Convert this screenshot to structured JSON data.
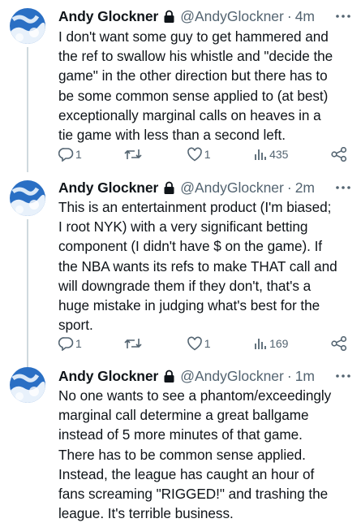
{
  "tweets": [
    {
      "author_name": "Andy Glockner",
      "handle": "@AndyGlockner",
      "separator": "·",
      "time": "4m",
      "text": "I don't want some guy to get hammered and\nthe ref to swallow his whistle and \"decide the\ngame\" in the other direction but there has to\nbe some common sense applied to (at best)\nexceptionally marginal calls on heaves in a\ntie game with less than a second left.",
      "reply_count": "1",
      "retweet_count": "",
      "like_count": "1",
      "view_count": "435"
    },
    {
      "author_name": "Andy Glockner",
      "handle": "@AndyGlockner",
      "separator": "·",
      "time": "2m",
      "text": "This is an entertainment product (I'm biased;\nI root NYK) with a very significant betting\ncomponent (I didn't have $ on the game). If\nthe NBA wants its refs to make THAT call and\nwill downgrade them if they don't, that's a\nhuge mistake in judging what's best for the\nsport.",
      "reply_count": "1",
      "retweet_count": "",
      "like_count": "1",
      "view_count": "169"
    },
    {
      "author_name": "Andy Glockner",
      "handle": "@AndyGlockner",
      "separator": "·",
      "time": "1m",
      "text": "No one wants to see a phantom/exceedingly\nmarginal call determine a great ballgame\ninstead of 5 more minutes of that game.\nThere has to be common sense applied.\nInstead, the league has caught an hour of\nfans screaming \"RIGGED!\" and trashing the\nleague. It's terrible business."
    }
  ],
  "icons": {
    "lock": "lock-icon",
    "more": "more-icon",
    "reply": "reply-icon",
    "retweet": "retweet-icon",
    "like": "like-icon",
    "views": "views-icon",
    "share": "share-icon"
  },
  "colors": {
    "text": "#0f1419",
    "secondary": "#536471",
    "thread_line": "#cfd9de",
    "avatar_sky": "#2a6fc4"
  }
}
